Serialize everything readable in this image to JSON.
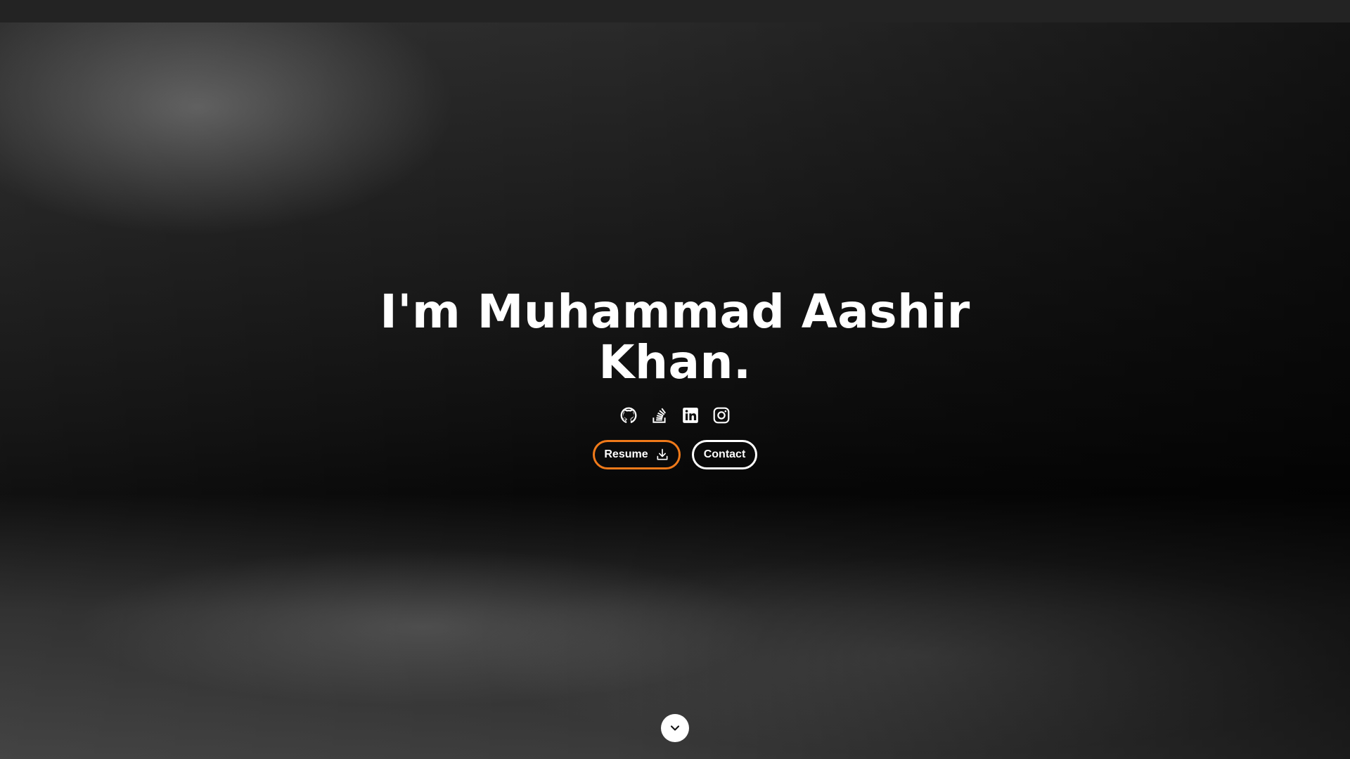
{
  "hero": {
    "title": "I'm Muhammad Aashir Khan."
  },
  "socials": [
    {
      "name": "GitHub",
      "icon": "github-icon"
    },
    {
      "name": "Stack Overflow",
      "icon": "stackoverflow-icon"
    },
    {
      "name": "LinkedIn",
      "icon": "linkedin-icon"
    },
    {
      "name": "Instagram",
      "icon": "instagram-icon"
    }
  ],
  "buttons": {
    "resume_label": "Resume",
    "resume_icon": "download-icon",
    "contact_label": "Contact"
  },
  "scroll": {
    "icon": "chevron-down-icon"
  },
  "colors": {
    "accent": "#f07a1a",
    "text": "#ffffff",
    "topbar": "#232323"
  }
}
